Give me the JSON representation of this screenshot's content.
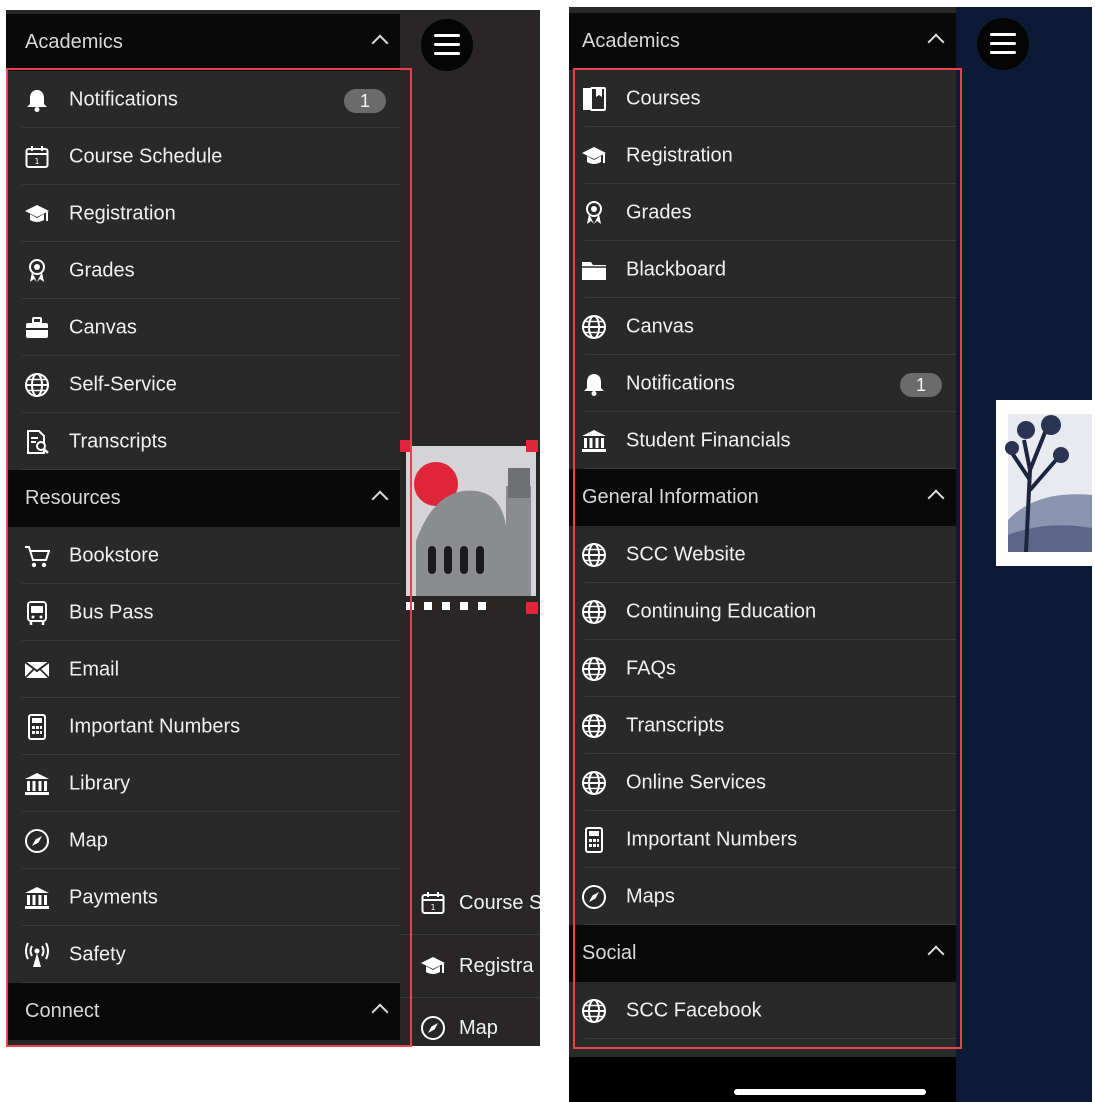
{
  "left": {
    "sections": [
      {
        "title": "Academics",
        "items": [
          {
            "label": "Notifications",
            "icon": "bell-icon",
            "badge": "1"
          },
          {
            "label": "Course Schedule",
            "icon": "calendar-icon"
          },
          {
            "label": "Registration",
            "icon": "graduation-cap-icon"
          },
          {
            "label": "Grades",
            "icon": "award-ribbon-icon"
          },
          {
            "label": "Canvas",
            "icon": "briefcase-icon"
          },
          {
            "label": "Self-Service",
            "icon": "globe-icon"
          },
          {
            "label": "Transcripts",
            "icon": "document-search-icon"
          }
        ]
      },
      {
        "title": "Resources",
        "items": [
          {
            "label": "Bookstore",
            "icon": "cart-icon"
          },
          {
            "label": "Bus Pass",
            "icon": "bus-icon"
          },
          {
            "label": "Email",
            "icon": "envelope-icon"
          },
          {
            "label": "Important Numbers",
            "icon": "calculator-icon"
          },
          {
            "label": "Library",
            "icon": "building-columns-icon"
          },
          {
            "label": "Map",
            "icon": "compass-icon"
          },
          {
            "label": "Payments",
            "icon": "building-columns-icon"
          },
          {
            "label": "Safety",
            "icon": "antenna-icon"
          }
        ]
      },
      {
        "title": "Connect",
        "items": []
      }
    ],
    "behind_items": [
      {
        "label": "Course S",
        "icon": "calendar-icon"
      },
      {
        "label": "Registra",
        "icon": "graduation-cap-icon"
      },
      {
        "label": "Map",
        "icon": "compass-icon"
      }
    ]
  },
  "right": {
    "sections": [
      {
        "title": "Academics",
        "items": [
          {
            "label": "Courses",
            "icon": "book-icon"
          },
          {
            "label": "Registration",
            "icon": "graduation-cap-icon"
          },
          {
            "label": "Grades",
            "icon": "award-ribbon-icon"
          },
          {
            "label": "Blackboard",
            "icon": "folder-icon"
          },
          {
            "label": "Canvas",
            "icon": "globe-icon"
          },
          {
            "label": "Notifications",
            "icon": "bell-icon",
            "badge": "1"
          },
          {
            "label": "Student Financials",
            "icon": "building-columns-icon"
          }
        ]
      },
      {
        "title": "General Information",
        "items": [
          {
            "label": "SCC Website",
            "icon": "globe-icon"
          },
          {
            "label": "Continuing Education",
            "icon": "globe-icon"
          },
          {
            "label": "FAQs",
            "icon": "globe-icon"
          },
          {
            "label": "Transcripts",
            "icon": "globe-icon"
          },
          {
            "label": "Online Services",
            "icon": "globe-icon"
          },
          {
            "label": "Important Numbers",
            "icon": "calculator-icon"
          },
          {
            "label": "Maps",
            "icon": "compass-icon"
          }
        ]
      },
      {
        "title": "Social",
        "items": [
          {
            "label": "SCC Facebook",
            "icon": "globe-icon"
          }
        ]
      }
    ]
  },
  "colors": {
    "highlight": "#e8434c",
    "drawer": "#2a2929",
    "header": "#090909",
    "right_background": "#0d1a36"
  }
}
